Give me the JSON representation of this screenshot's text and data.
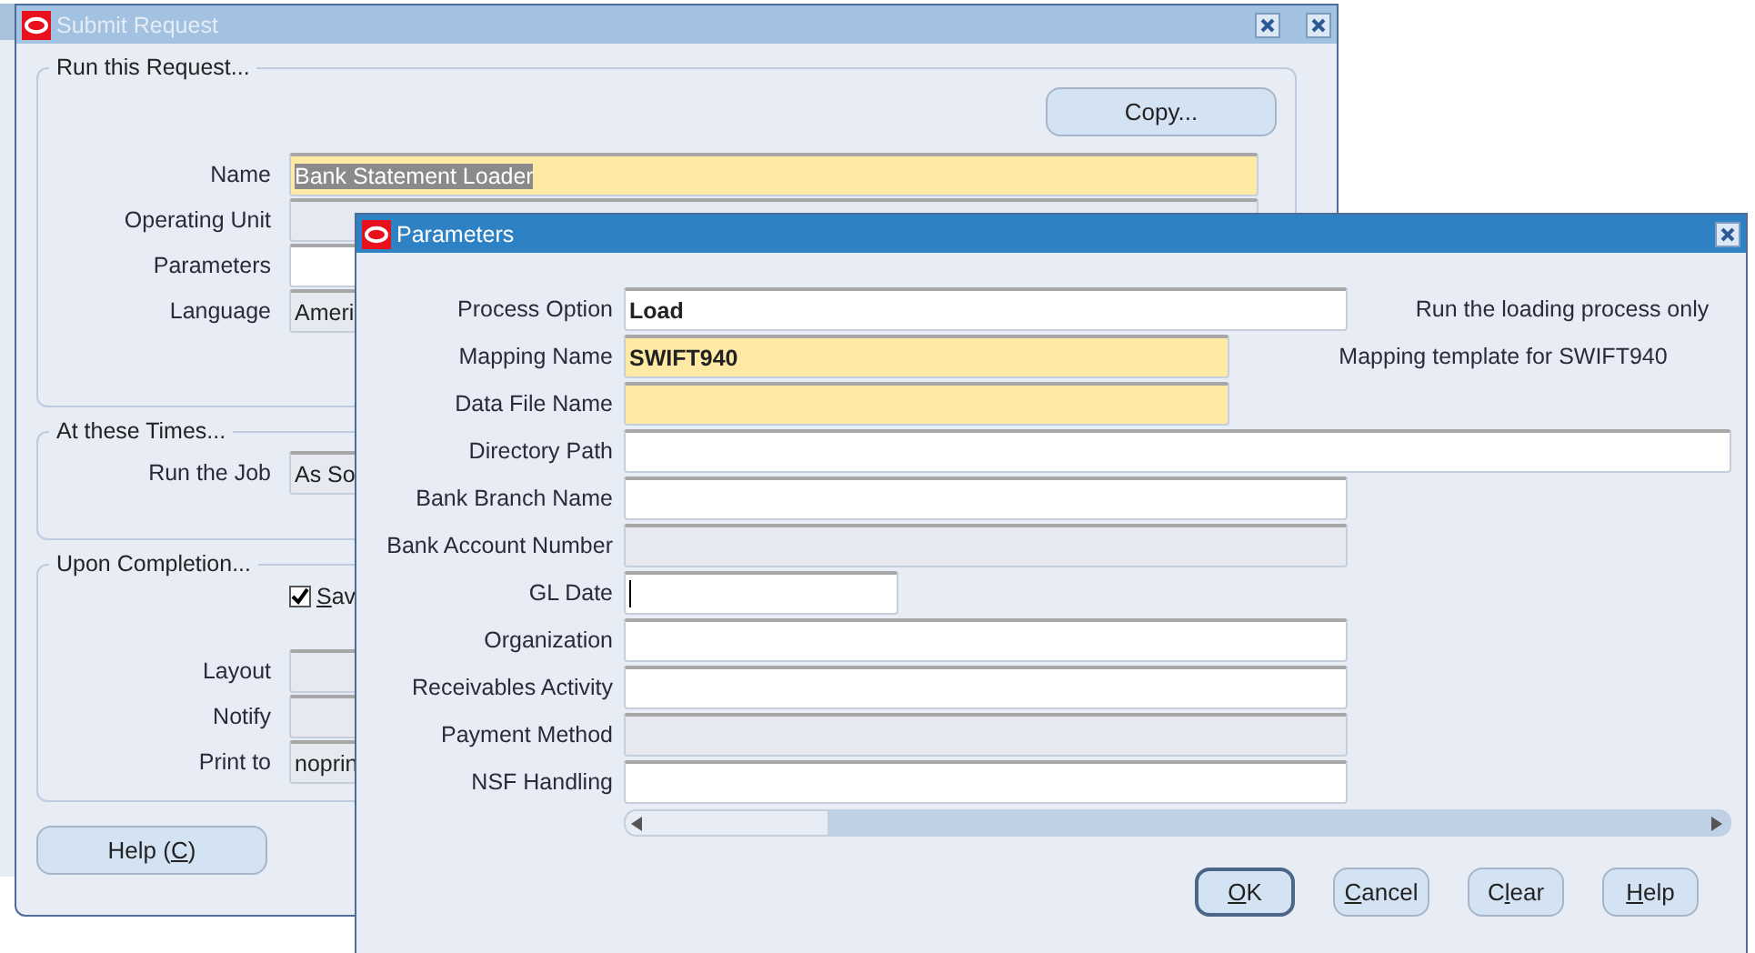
{
  "submit_window": {
    "title": "Submit Request",
    "active": false,
    "run_group": {
      "title": "Run this Request...",
      "copy_button": {
        "pre": "Copy..."
      },
      "fields": [
        {
          "label": "Name",
          "value": "Bank Statement Loader",
          "kind": "required",
          "selected": true
        },
        {
          "label": "Operating Unit",
          "kind": "disabled"
        },
        {
          "label": "Parameters",
          "kind": "normal"
        },
        {
          "label": "Language",
          "value": "Ameri",
          "kind": "disabled"
        }
      ]
    },
    "times_group": {
      "title": "At these Times...",
      "fields": [
        {
          "label": "Run the Job",
          "value": "As So",
          "kind": "disabled"
        }
      ]
    },
    "completion_group": {
      "title": "Upon Completion...",
      "save_checkbox": {
        "key": "S",
        "post": "av",
        "checked": true
      },
      "fields": [
        {
          "label": "Layout",
          "kind": "disabled"
        },
        {
          "label": "Notify",
          "kind": "disabled"
        },
        {
          "label": "Print to",
          "value": "noprin",
          "kind": "disabled"
        }
      ]
    },
    "help_button": {
      "pre": "Help (",
      "key": "C",
      "post": ")"
    }
  },
  "parameters_window": {
    "title": "Parameters",
    "active": true,
    "fields": [
      {
        "label": "Process Option",
        "value": "Load",
        "kind": "normal",
        "description": "Run the loading process only"
      },
      {
        "label": "Mapping Name",
        "value": "SWIFT940",
        "kind": "required",
        "description": "Mapping template for SWIFT940"
      },
      {
        "label": "Data File Name",
        "kind": "required"
      },
      {
        "label": "Directory Path",
        "kind": "normal"
      },
      {
        "label": "Bank Branch Name",
        "kind": "normal"
      },
      {
        "label": "Bank Account Number",
        "kind": "disabled"
      },
      {
        "label": "GL Date",
        "kind": "normal",
        "focused": true
      },
      {
        "label": "Organization",
        "kind": "normal"
      },
      {
        "label": "Receivables Activity",
        "kind": "normal"
      },
      {
        "label": "Payment Method",
        "kind": "disabled"
      },
      {
        "label": "NSF Handling",
        "kind": "normal"
      }
    ],
    "buttons": [
      {
        "key": "O",
        "post": "K",
        "default": true
      },
      {
        "key": "C",
        "post": "ancel",
        "default": false
      },
      {
        "pre": "C",
        "key": "l",
        "post": "ear",
        "default": false
      },
      {
        "key": "H",
        "post": "elp",
        "default": false
      }
    ]
  }
}
